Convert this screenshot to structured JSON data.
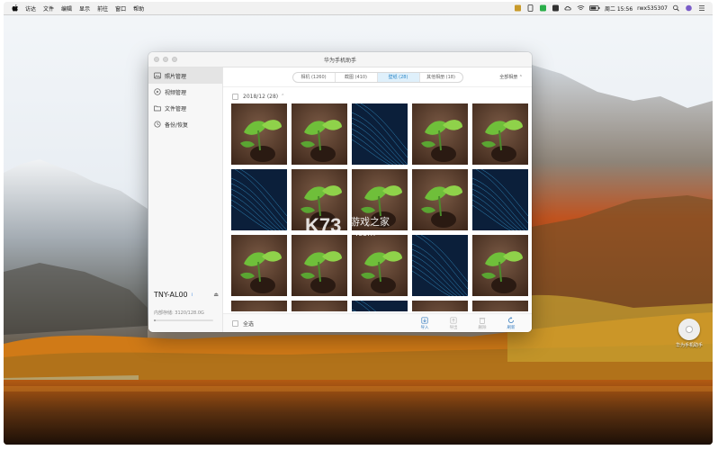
{
  "menubar": {
    "items": [
      "访达",
      "文件",
      "编辑",
      "显示",
      "前往",
      "窗口",
      "帮助"
    ],
    "clock": "周二 15:56",
    "user": "rwx535307"
  },
  "window": {
    "title": "华为手机助手",
    "sidebar": {
      "items": [
        "照片管理",
        "视频管理",
        "文件管理",
        "备份/恢复"
      ],
      "device_name": "TNY-AL00",
      "storage": "内部存储: 3120/128.0G",
      "storage_used_fraction": 0.03
    },
    "tabs": [
      "相机 (1260)",
      "截图 (410)",
      "壁纸 (28)",
      "其他相册 (18)"
    ],
    "active_tab_index": 2,
    "filter": "全部相册",
    "group_header": "2018/12 (28)",
    "select_all": "全选",
    "actions": [
      "导入",
      "导出",
      "删除",
      "刷新"
    ]
  },
  "desktop_icon": {
    "label": "华为手机助手"
  },
  "watermark": {
    "line1": "游戏之家",
    "line2": ".com"
  },
  "colors": {
    "accent": "#2b87c8",
    "active_tab_bg": "#dff0fb",
    "sidebar_bg": "#f7f7f7"
  }
}
